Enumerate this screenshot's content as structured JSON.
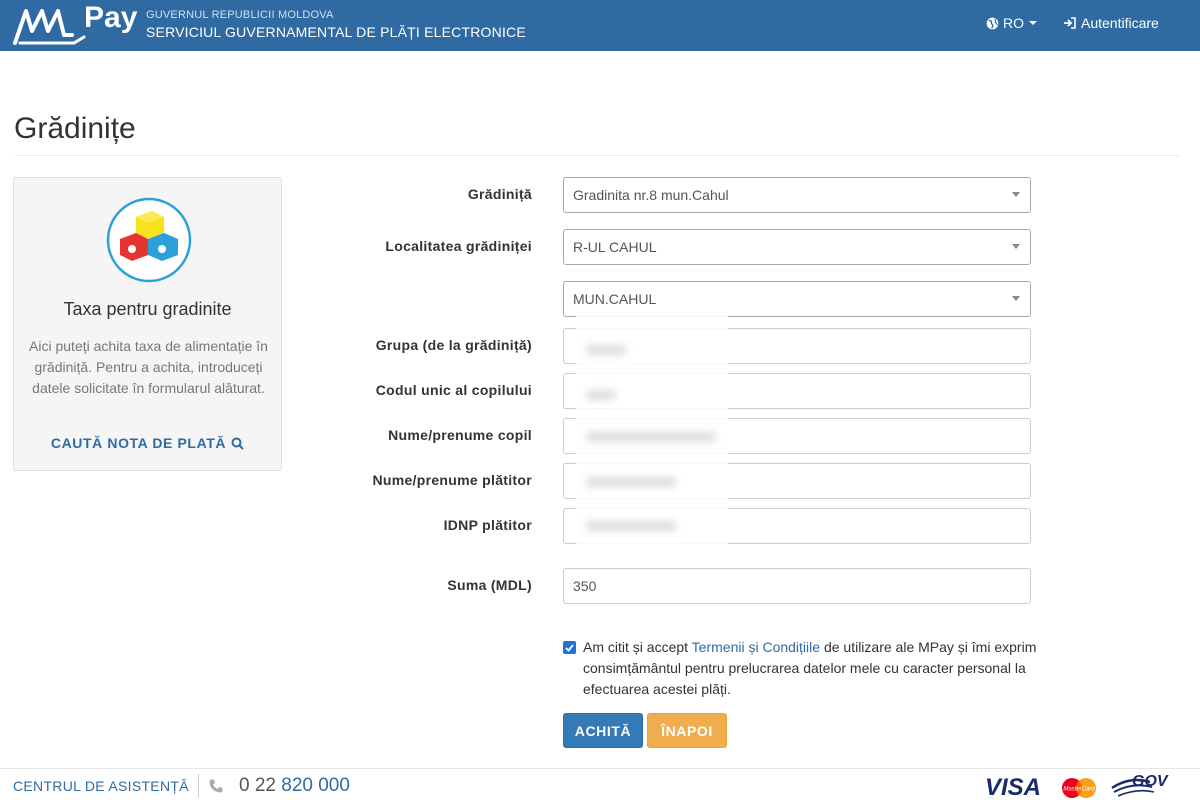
{
  "header": {
    "logo_text": "Pay",
    "gov_small": "GUVERNUL REPUBLICII MOLDOVA",
    "gov_big": "SERVICIUL GUVERNAMENTAL DE PLĂȚI ELECTRONICE",
    "lang": "RO",
    "login": "Autentificare",
    "colors": {
      "bar": "#2f6aa3"
    }
  },
  "page": {
    "title": "Grădinițe"
  },
  "panel": {
    "title": "Taxa pentru gradinite",
    "text": "Aici puteți achita taxa de alimentație în grădiniță. Pentru a achita, introduceți datele solicitate în formularul alăturat.",
    "link": "CAUTĂ NOTA DE PLATĂ",
    "icon": "toy-blocks-icon"
  },
  "form": {
    "gradinita": {
      "label": "Grădiniță",
      "value": "Gradinita nr.8 mun.Cahul"
    },
    "localitate": {
      "label": "Localitatea grădiniței",
      "value": "R-UL CAHUL"
    },
    "localitate2": {
      "value": "MUN.CAHUL"
    },
    "grupa": {
      "label": "Grupa (de la grădiniță)",
      "value": ""
    },
    "cod": {
      "label": "Codul unic al copilului",
      "value": ""
    },
    "nume_copil": {
      "label": "Nume/prenume copil",
      "value": ""
    },
    "nume_platitor": {
      "label": "Nume/prenume plătitor",
      "value": ""
    },
    "idnp": {
      "label": "IDNP plătitor",
      "value": ""
    },
    "suma": {
      "label": "Suma (MDL)",
      "value": "350"
    }
  },
  "terms": {
    "checked": true,
    "before": "Am citit și accept ",
    "link": "Termenii și Condițiile",
    "after": " de utilizare ale MPay și îmi exprim consimțământul pentru prelucrarea datelor mele cu caracter personal la efectuarea acestei plăți."
  },
  "buttons": {
    "pay": "ACHITĂ",
    "back": "ÎNAPOI"
  },
  "footer": {
    "help": "CENTRUL DE ASISTENȚĂ",
    "phone_prefix": "0 22 ",
    "phone_main": "820 000",
    "visa": "VISA",
    "mastercard": "MasterCard",
    "gov": "GOV"
  }
}
